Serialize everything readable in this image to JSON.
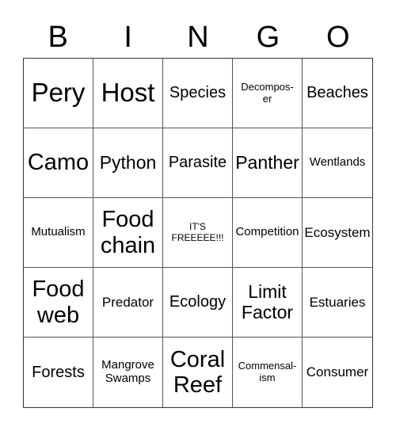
{
  "header": {
    "letters": [
      "B",
      "I",
      "N",
      "G",
      "O"
    ]
  },
  "board": {
    "rows": [
      [
        {
          "text": "Pery",
          "size": "s-xl"
        },
        {
          "text": "Host",
          "size": "s-xl"
        },
        {
          "text": "Species",
          "size": "s-md"
        },
        {
          "text": "Decompos-\ner",
          "size": "s-xxs"
        },
        {
          "text": "Beaches",
          "size": "s-md"
        }
      ],
      [
        {
          "text": "Camo",
          "size": "s-lg"
        },
        {
          "text": "Python",
          "size": "s-md2"
        },
        {
          "text": "Parasite",
          "size": "s-md"
        },
        {
          "text": "Panther",
          "size": "s-md2"
        },
        {
          "text": "Wentlands",
          "size": "s-xs"
        }
      ],
      [
        {
          "text": "Mutualism",
          "size": "s-xs"
        },
        {
          "text": "Food\nchain",
          "size": "s-lg"
        },
        {
          "text": "IT'S\nFREEEEE!!!",
          "size": "s-tiny",
          "free": true
        },
        {
          "text": "Competition",
          "size": "s-xs"
        },
        {
          "text": "Ecosystem",
          "size": "s-sm"
        }
      ],
      [
        {
          "text": "Food\nweb",
          "size": "s-lg"
        },
        {
          "text": "Predator",
          "size": "s-sm"
        },
        {
          "text": "Ecology",
          "size": "s-md"
        },
        {
          "text": "Limit\nFactor",
          "size": "s-md2"
        },
        {
          "text": "Estuaries",
          "size": "s-sm"
        }
      ],
      [
        {
          "text": "Forests",
          "size": "s-md"
        },
        {
          "text": "Mangrove\nSwamps",
          "size": "s-xs"
        },
        {
          "text": "Coral\nReef",
          "size": "s-lg"
        },
        {
          "text": "Commensal-\nism",
          "size": "s-xxs"
        },
        {
          "text": "Consumer",
          "size": "s-sm"
        }
      ]
    ]
  }
}
